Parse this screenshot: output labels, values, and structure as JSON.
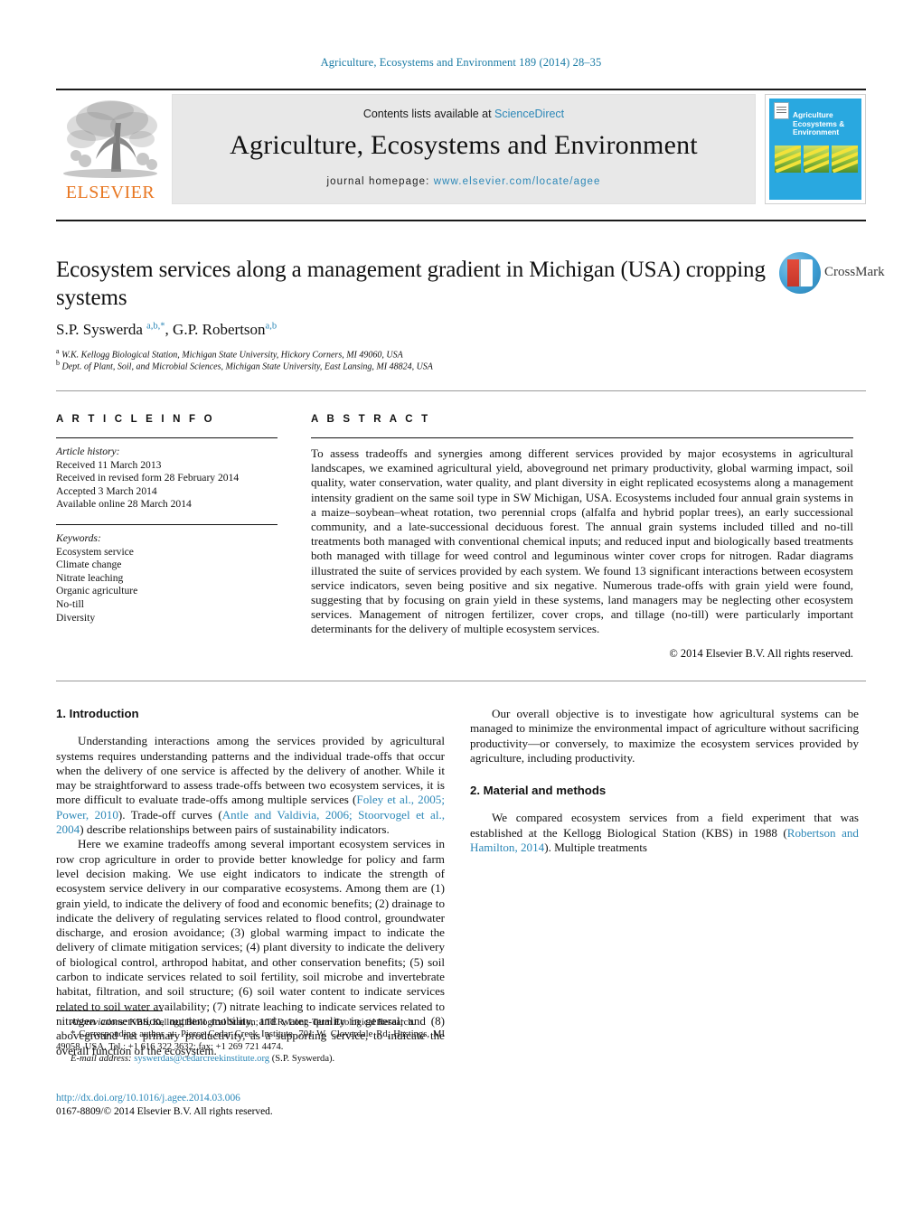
{
  "running_head": "Agriculture, Ecosystems and Environment 189 (2014) 28–35",
  "header": {
    "contents_prefix": "Contents lists available at ",
    "contents_link": "ScienceDirect",
    "journal_name": "Agriculture, Ecosystems and Environment",
    "homepage_label": "journal homepage: ",
    "homepage_url": "www.elsevier.com/locate/agee",
    "publisher_logo_text": "ELSEVIER",
    "cover_title": "Agriculture\nEcosystems &\nEnvironment"
  },
  "article": {
    "title": "Ecosystem services along a management gradient in Michigan (USA) cropping systems",
    "authors_html": "S.P. Syswerda <sup>a,b,*</sup>, G.P. Robertson<sup>a,b</sup>",
    "affiliation_a": "W.K. Kellogg Biological Station, Michigan State University, Hickory Corners, MI 49060, USA",
    "affiliation_b": "Dept. of Plant, Soil, and Microbial Sciences, Michigan State University, East Lansing, MI 48824, USA",
    "crossmark_label": "CrossMark"
  },
  "article_info": {
    "heading": "A R T I C L E   I N F O",
    "history_label": "Article history:",
    "history": [
      "Received 11 March 2013",
      "Received in revised form 28 February 2014",
      "Accepted 3 March 2014",
      "Available online 28 March 2014"
    ],
    "keywords_label": "Keywords:",
    "keywords": [
      "Ecosystem service",
      "Climate change",
      "Nitrate leaching",
      "Organic agriculture",
      "No-till",
      "Diversity"
    ]
  },
  "abstract": {
    "heading": "A B S T R A C T",
    "text": "To assess tradeoffs and synergies among different services provided by major ecosystems in agricultural landscapes, we examined agricultural yield, aboveground net primary productivity, global warming impact, soil quality, water conservation, water quality, and plant diversity in eight replicated ecosystems along a management intensity gradient on the same soil type in SW Michigan, USA. Ecosystems included four annual grain systems in a maize–soybean–wheat rotation, two perennial crops (alfalfa and hybrid poplar trees), an early successional community, and a late-successional deciduous forest. The annual grain systems included tilled and no-till treatments both managed with conventional chemical inputs; and reduced input and biologically based treatments both managed with tillage for weed control and leguminous winter cover crops for nitrogen. Radar diagrams illustrated the suite of services provided by each system. We found 13 significant interactions between ecosystem service indicators, seven being positive and six negative. Numerous trade-offs with grain yield were found, suggesting that by focusing on grain yield in these systems, land managers may be neglecting other ecosystem services. Management of nitrogen fertilizer, cover crops, and tillage (no-till) were particularly important determinants for the delivery of multiple ecosystem services.",
    "copyright": "© 2014 Elsevier B.V. All rights reserved."
  },
  "body": {
    "section1_heading": "1. Introduction",
    "p1_part1": "Understanding interactions among the services provided by agricultural systems requires understanding patterns and the individual trade-offs that occur when the delivery of one service is affected by the delivery of another. While it may be straightforward to assess trade-offs between two ecosystem services, it is more difficult to evaluate trade-offs among multiple services (",
    "p1_ref1": "Foley et al., 2005; Power, 2010",
    "p1_part2": "). Trade-off curves (",
    "p1_ref2": "Antle and Valdivia, 2006; Stoorvogel et al., 2004",
    "p1_part3": ") describe relationships between pairs of sustainability indicators.",
    "p2": "Here we examine tradeoffs among several important ecosystem services in row crop agriculture in order to provide better knowledge for policy and farm level decision making. We use eight indicators to indicate the strength of ecosystem service delivery in our comparative ecosystems. Among them are (1) grain yield, to indicate the delivery of food and economic benefits; (2) drainage to indicate the delivery of regulating services related to flood control, groundwater discharge, and erosion avoidance; (3) global warming impact to indicate the delivery of climate mitigation services; (4) plant diversity to indicate the delivery of biological control, arthropod habitat, and other conservation benefits; (5) soil carbon to indicate services related to soil fertility, soil microbe and invertebrate habitat, filtration, and soil structure; (6) soil water content to indicate services related to soil water availability; (7) nitrate leaching to indicate services related to nitrogen conservation, nutrient mobility, and water quality in general; and (8) aboveground net primary productivity, as a supporting service, to indicate the overall function of the ecosystem.",
    "p3": "Our overall objective is to investigate how agricultural systems can be managed to minimize the environmental impact of agriculture without sacrificing productivity—or conversely, to maximize the ecosystem services provided by agriculture, including productivity.",
    "section2_heading": "2. Material and methods",
    "p4_part1": "We compared ecosystem services from a field experiment that was established at the Kellogg Biological Station (KBS) in 1988 (",
    "p4_ref1": "Robertson and Hamilton, 2014",
    "p4_part2": "). Multiple treatments"
  },
  "footnotes": {
    "abbrev_label": "Abbreviations:",
    "abbrev_text": " KBS, Kellogg Biological Station; LTER, Long-Term Ecological Research.",
    "corresponding": "* Corresponding author at: Pierce Cedar Creek Institute, 701 W. Cloverdale Rd, Hastings, MI 49058, USA. Tel.: +1 616 322 3632; fax: +1 269 721 4474.",
    "email_label": "E-mail address:",
    "email_link": "syswerdas@cedarcreekinstitute.org",
    "email_suffix": " (S.P. Syswerda).",
    "doi": "http://dx.doi.org/10.1016/j.agee.2014.03.006",
    "issn_line": "0167-8809/© 2014 Elsevier B.V. All rights reserved."
  },
  "colors": {
    "link": "#2b87b7",
    "running_head": "#1a7ba5",
    "elsevier_orange": "#e87722",
    "cover_blue": "#29a8e0"
  }
}
